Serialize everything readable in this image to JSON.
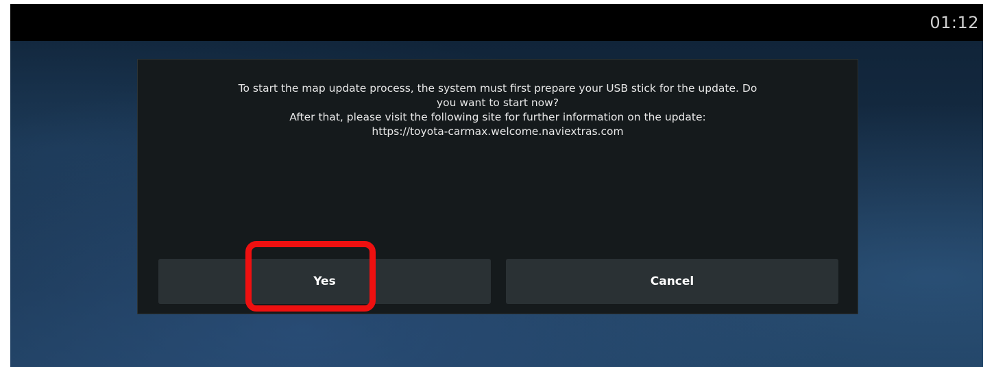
{
  "status_bar": {
    "time": "01:12"
  },
  "dialog": {
    "message_lines": [
      "To start the map update process, the system must first prepare your USB stick for the update. Do",
      "you want to start now?",
      "After that, please visit the following site for further information on the update:",
      "https://toyota-carmax.welcome.naviextras.com"
    ],
    "buttons": {
      "yes_label": "Yes",
      "cancel_label": "Cancel"
    }
  },
  "colors": {
    "status_bar_bg": "#000000",
    "dialog_bg": "#151a1c",
    "button_bg": "#2a3134",
    "highlight": "#ee1010"
  }
}
